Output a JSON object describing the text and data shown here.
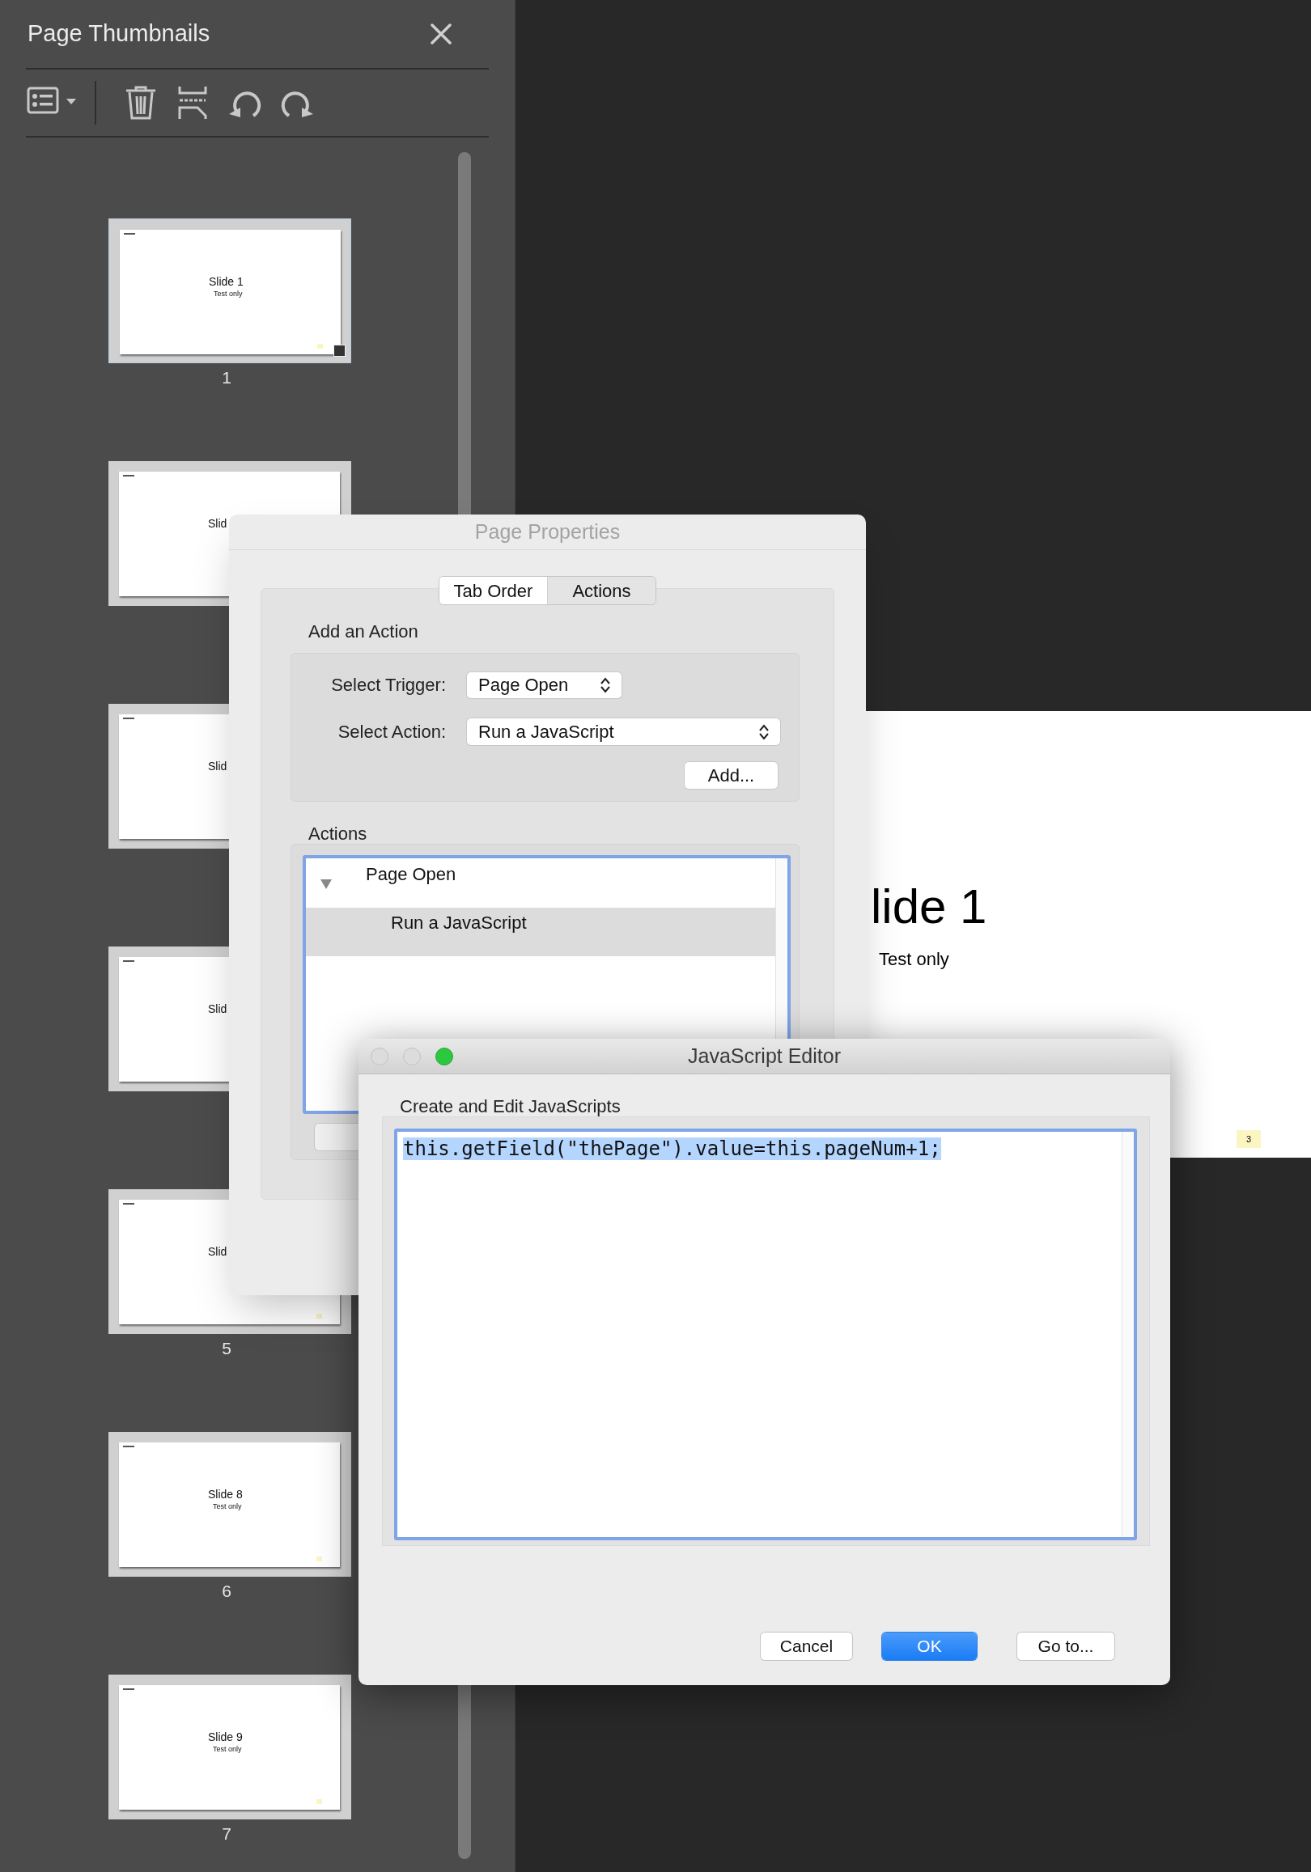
{
  "thumbnails_panel": {
    "title": "Page Thumbnails",
    "thumbnails": [
      {
        "number": "1",
        "title": "Slide 1",
        "subtitle": "Test only",
        "selected": true
      },
      {
        "title": "Slid",
        "selected": false
      },
      {
        "title": "Slid",
        "selected": false
      },
      {
        "title": "Slid",
        "selected": false
      },
      {
        "number": "5",
        "title": "Slid",
        "selected": false
      },
      {
        "number": "6",
        "title": "Slide 8",
        "subtitle": "Test only",
        "selected": false
      },
      {
        "number": "7",
        "title": "Slide 9",
        "subtitle": "Test only",
        "selected": false
      }
    ]
  },
  "page_view": {
    "title": "lide 1",
    "subtitle": "Test only",
    "page_badge": "3"
  },
  "page_properties": {
    "title": "Page Properties",
    "tabs": [
      {
        "label": "Tab Order",
        "selected": false
      },
      {
        "label": "Actions",
        "selected": true
      }
    ],
    "add_action": {
      "heading": "Add an Action",
      "trigger_label": "Select Trigger:",
      "trigger_value": "Page Open",
      "action_label": "Select Action:",
      "action_value": "Run a JavaScript",
      "add_button": "Add..."
    },
    "actions": {
      "heading": "Actions",
      "tree": [
        {
          "label": "Page Open",
          "expanded": true,
          "selected": false,
          "children": [
            {
              "label": "Run a JavaScript",
              "selected": true
            }
          ]
        }
      ]
    }
  },
  "javascript_editor": {
    "title": "JavaScript Editor",
    "prompt": "Create and Edit JavaScripts",
    "code": "this.getField(\"thePage\").value=this.pageNum+1;",
    "code_selected": true,
    "buttons": [
      {
        "label": "Cancel",
        "kind": "default"
      },
      {
        "label": "OK",
        "kind": "primary"
      },
      {
        "label": "Go to...",
        "kind": "default"
      }
    ]
  }
}
